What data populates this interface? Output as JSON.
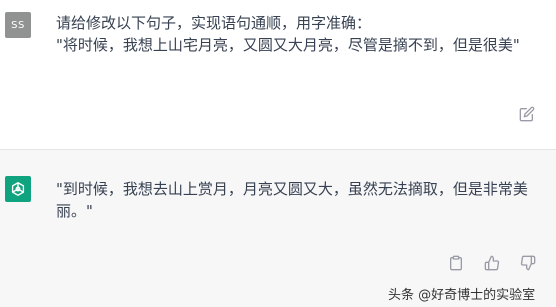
{
  "user_message": {
    "avatar_initials": "SS",
    "text": "请给修改以下句子，实现语句通顺，用字准确：\n\"将时候，我想上山宅月亮，又圆又大月亮，尽管是摘不到，但是很美\""
  },
  "assistant_message": {
    "text": "\"到时候，我想去山上赏月，月亮又圆又大，虽然无法摘取，但是非常美丽。\""
  },
  "watermark": {
    "text": "头条 @好奇博士的实验室"
  },
  "icons": {
    "edit": "edit-icon",
    "copy": "copy-icon",
    "thumbs_up": "thumbs-up-icon",
    "thumbs_down": "thumbs-down-icon",
    "brand": "openai-logo-icon"
  },
  "colors": {
    "user_avatar_bg": "#909392",
    "assistant_avatar_bg": "#10a37f",
    "assistant_row_bg": "#f7f7f8"
  }
}
